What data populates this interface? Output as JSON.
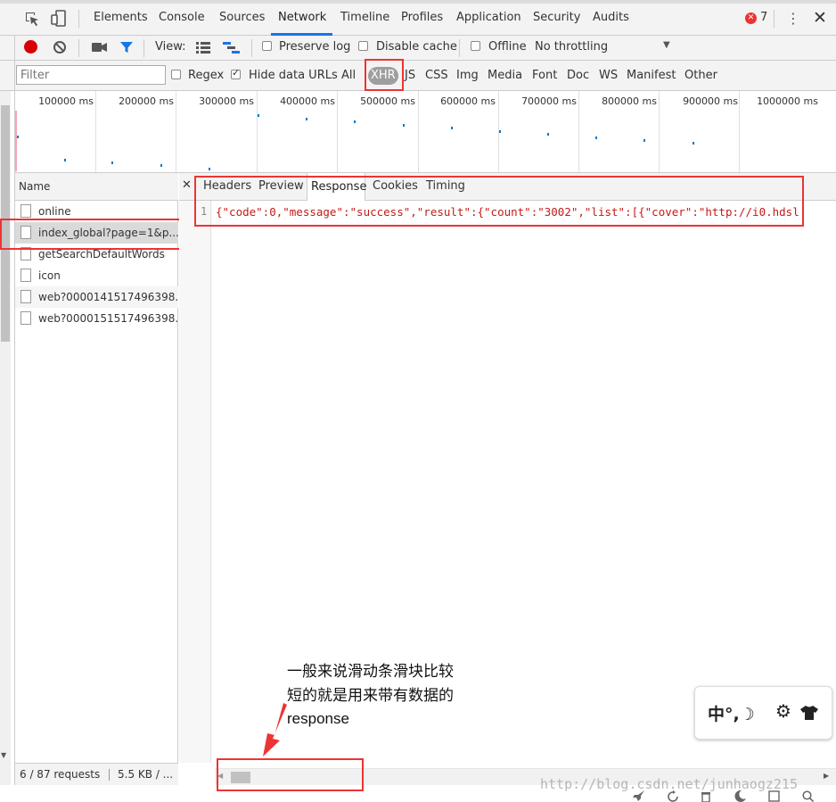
{
  "topbar": {
    "tabs": [
      "Elements",
      "Console",
      "Sources",
      "Network",
      "Timeline",
      "Profiles",
      "Application",
      "Security",
      "Audits"
    ],
    "active_tab": "Network",
    "error_count": "7"
  },
  "toolbar": {
    "view_label": "View:",
    "preserve_log": "Preserve log",
    "disable_cache": "Disable cache",
    "offline": "Offline",
    "throttling": "No throttling"
  },
  "filterbar": {
    "placeholder": "Filter",
    "regex": "Regex",
    "hide_data_urls": "Hide data URLs",
    "types": [
      "All",
      "XHR",
      "JS",
      "CSS",
      "Img",
      "Media",
      "Font",
      "Doc",
      "WS",
      "Manifest",
      "Other"
    ],
    "active_type": "XHR"
  },
  "timeline": {
    "labels": [
      "100000 ms",
      "200000 ms",
      "300000 ms",
      "400000 ms",
      "500000 ms",
      "600000 ms",
      "700000 ms",
      "800000 ms",
      "900000 ms",
      "1000000 ms"
    ]
  },
  "requests": {
    "header": "Name",
    "items": [
      "online",
      "index_global?page=1&p...",
      "getSearchDefaultWords",
      "icon",
      "web?0000141517496398...",
      "web?0000151517496398..."
    ],
    "selected_index": 1,
    "status_count": "6 / 87 requests",
    "status_size": "5.5 KB / ..."
  },
  "details": {
    "tabs": [
      "Headers",
      "Preview",
      "Response",
      "Cookies",
      "Timing"
    ],
    "active_tab": "Response",
    "line_number": "1",
    "response_text": "{\"code\":0,\"message\":\"success\",\"result\":{\"count\":\"3002\",\"list\":[{\"cover\":\"http://i0.hdsl"
  },
  "annotation": {
    "line1": "一般来说滑动条滑块比较",
    "line2": "短的就是用来带有数据的",
    "line3": "response"
  },
  "ime_toolbar": {
    "text": "中°,☽"
  },
  "watermark": "http://blog.csdn.net/junhaogz215",
  "colors": {
    "accent": "#e33333",
    "record": "#d80000",
    "filter_blue": "#1a73e8",
    "selected_row": "#dadada"
  }
}
